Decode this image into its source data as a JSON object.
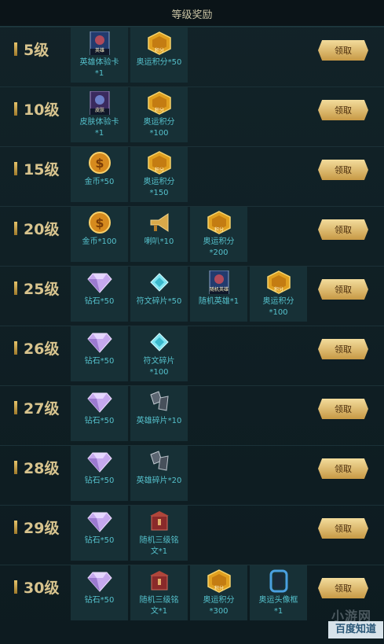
{
  "title": "等级奖励",
  "claim_label": "领取",
  "icon_names": {
    "hero_card": "hero-card-icon",
    "skin_card": "skin-card-icon",
    "points": "points-icon",
    "coin": "coin-icon",
    "trumpet": "trumpet-icon",
    "diamond": "diamond-icon",
    "rune_shard": "rune-shard-icon",
    "hero_shard": "hero-shard-icon",
    "rune_box": "rune-box-icon",
    "avatar_frame": "avatar-frame-icon"
  },
  "rows": [
    {
      "level": "5级",
      "items": [
        {
          "icon": "hero_card",
          "badge": "英雄",
          "lines": [
            "英雄体验卡",
            "*1"
          ]
        },
        {
          "icon": "points",
          "badge": "积分",
          "lines": [
            "奥运积分*50"
          ]
        }
      ]
    },
    {
      "level": "10级",
      "items": [
        {
          "icon": "skin_card",
          "badge": "皮肤",
          "lines": [
            "皮肤体验卡",
            "*1"
          ]
        },
        {
          "icon": "points",
          "badge": "积分",
          "lines": [
            "奥运积分",
            "*100"
          ]
        }
      ]
    },
    {
      "level": "15级",
      "items": [
        {
          "icon": "coin",
          "lines": [
            "金币*50"
          ]
        },
        {
          "icon": "points",
          "badge": "积分",
          "lines": [
            "奥运积分",
            "*150"
          ]
        }
      ]
    },
    {
      "level": "20级",
      "items": [
        {
          "icon": "coin",
          "lines": [
            "金币*100"
          ]
        },
        {
          "icon": "trumpet",
          "lines": [
            "喇叭*10"
          ]
        },
        {
          "icon": "points",
          "badge": "积分",
          "lines": [
            "奥运积分",
            "*200"
          ]
        }
      ]
    },
    {
      "level": "25级",
      "items": [
        {
          "icon": "diamond",
          "lines": [
            "钻石*50"
          ]
        },
        {
          "icon": "rune_shard",
          "lines": [
            "符文碎片*50"
          ]
        },
        {
          "icon": "hero_card",
          "badge": "随机英雄",
          "lines": [
            "随机英雄*1"
          ]
        },
        {
          "icon": "points",
          "badge": "积分",
          "lines": [
            "奥运积分",
            "*100"
          ]
        }
      ]
    },
    {
      "level": "26级",
      "items": [
        {
          "icon": "diamond",
          "lines": [
            "钻石*50"
          ]
        },
        {
          "icon": "rune_shard",
          "lines": [
            "符文碎片",
            "*100"
          ]
        }
      ]
    },
    {
      "level": "27级",
      "items": [
        {
          "icon": "diamond",
          "lines": [
            "钻石*50"
          ]
        },
        {
          "icon": "hero_shard",
          "lines": [
            "英雄碎片*10"
          ]
        }
      ]
    },
    {
      "level": "28级",
      "items": [
        {
          "icon": "diamond",
          "lines": [
            "钻石*50"
          ]
        },
        {
          "icon": "hero_shard",
          "lines": [
            "英雄碎片*20"
          ]
        }
      ]
    },
    {
      "level": "29级",
      "items": [
        {
          "icon": "diamond",
          "lines": [
            "钻石*50"
          ]
        },
        {
          "icon": "rune_box",
          "lines": [
            "随机三级铭",
            "文*1"
          ]
        }
      ]
    },
    {
      "level": "30级",
      "items": [
        {
          "icon": "diamond",
          "lines": [
            "钻石*50"
          ]
        },
        {
          "icon": "rune_box",
          "lines": [
            "随机三级铭",
            "文*1"
          ]
        },
        {
          "icon": "points",
          "badge": "积分",
          "lines": [
            "奥运积分",
            "*300"
          ]
        },
        {
          "icon": "avatar_frame",
          "lines": [
            "奥运头像框",
            "*1"
          ]
        }
      ]
    }
  ],
  "watermark": {
    "top": "小游网",
    "bottom": "百度知道"
  },
  "colors": {
    "background": "#0f1f24",
    "title_text": "#c9c3a4",
    "level_text": "#d8c48e",
    "item_label": "#55c1cc",
    "claim_button": "#e2bd6d",
    "points_badge": "#e0a020"
  }
}
